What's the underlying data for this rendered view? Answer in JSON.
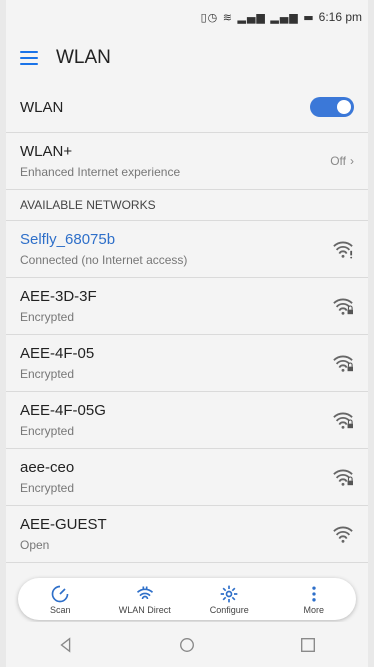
{
  "status_bar": {
    "time": "6:16 pm",
    "icons": "vibrate alarm wifi signal signal battery"
  },
  "app_bar": {
    "title": "WLAN"
  },
  "wlan": {
    "label": "WLAN",
    "enabled": true
  },
  "wlan_plus": {
    "label": "WLAN+",
    "subtitle": "Enhanced Internet experience",
    "value": "Off"
  },
  "section_header": "AVAILABLE NETWORKS",
  "networks": [
    {
      "name": "Selfly_68075b",
      "status": "Connected (no Internet access)",
      "connected": true,
      "icon": "wifi-warning-icon"
    },
    {
      "name": "AEE-3D-3F",
      "status": "Encrypted",
      "icon": "wifi-locked-icon"
    },
    {
      "name": "AEE-4F-05",
      "status": "Encrypted",
      "icon": "wifi-locked-icon"
    },
    {
      "name": "AEE-4F-05G",
      "status": "Encrypted",
      "icon": "wifi-locked-icon"
    },
    {
      "name": "aee-ceo",
      "status": "Encrypted",
      "icon": "wifi-locked-icon"
    },
    {
      "name": "AEE-GUEST",
      "status": "Open",
      "icon": "wifi-open-icon"
    }
  ],
  "bottom_bar": [
    {
      "label": "Scan",
      "icon": "scan-icon"
    },
    {
      "label": "WLAN Direct",
      "icon": "wlan-direct-icon"
    },
    {
      "label": "Configure",
      "icon": "gear-icon"
    },
    {
      "label": "More",
      "icon": "more-vertical-icon"
    }
  ],
  "colors": {
    "accent": "#3b78d8",
    "connected": "#2e6fc9"
  }
}
